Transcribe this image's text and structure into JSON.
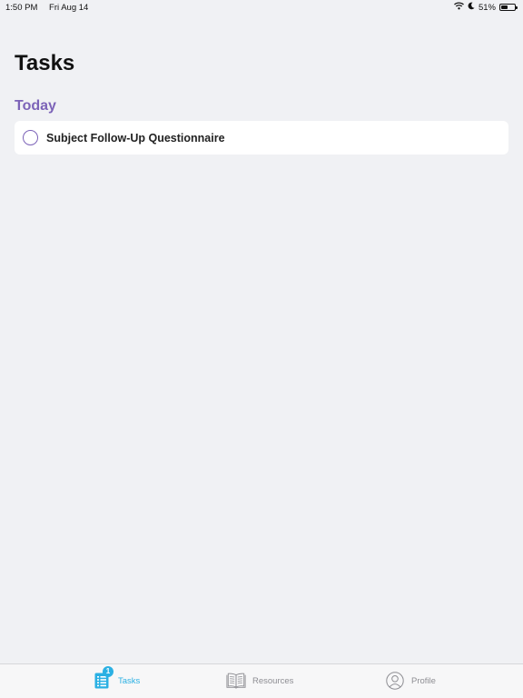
{
  "colors": {
    "accent": "#2bb0e3",
    "section_title": "#7c63b8",
    "checkbox_border": "#7c63b8",
    "tab_inactive": "#8e8e93"
  },
  "status_bar": {
    "time": "1:50 PM",
    "date": "Fri Aug 14",
    "battery_percent": "51%",
    "battery_level": 0.51,
    "icons": [
      "wifi-icon",
      "moon-icon",
      "battery-icon"
    ]
  },
  "page": {
    "title": "Tasks"
  },
  "sections": [
    {
      "title": "Today",
      "tasks": [
        {
          "label": "Subject Follow-Up Questionnaire",
          "completed": false
        }
      ]
    }
  ],
  "tab_bar": {
    "tabs": [
      {
        "label": "Tasks",
        "icon": "task-list-icon",
        "selected": true,
        "badge": "1"
      },
      {
        "label": "Resources",
        "icon": "book-icon",
        "selected": false
      },
      {
        "label": "Profile",
        "icon": "profile-icon",
        "selected": false
      }
    ]
  }
}
